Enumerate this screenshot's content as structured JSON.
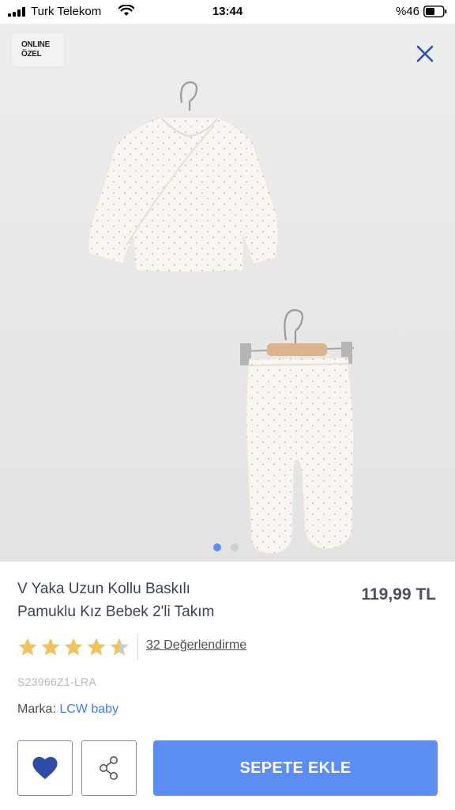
{
  "status_bar": {
    "carrier": "Turk Telekom",
    "time": "13:44",
    "battery": "%46"
  },
  "hero": {
    "badge_line1": "ONLINE",
    "badge_line2": "ÖZEL",
    "close_icon": "close-icon",
    "carousel": {
      "total": 2,
      "active": 1
    }
  },
  "product": {
    "title_line1": "V Yaka Uzun Kollu Baskılı",
    "title_line2": "Pamuklu Kız Bebek 2'li Takım",
    "price": "119,99 TL",
    "rating_value": 4.5,
    "rating_link": "32 Değerlendirme",
    "sku": "S23966Z1-LRA",
    "brand_label": "Marka: ",
    "brand_name": "LCW baby"
  },
  "actions": {
    "favorite_icon": "heart-icon",
    "share_icon": "share-icon",
    "cart_label": "SEPETE EKLE"
  },
  "colors": {
    "accent": "#5b8df2",
    "link": "#3d7cf0",
    "star": "#f0c25c",
    "text": "#3b4252",
    "dot_active": "#5b8df2",
    "dot_inactive": "#cfcfcf"
  }
}
